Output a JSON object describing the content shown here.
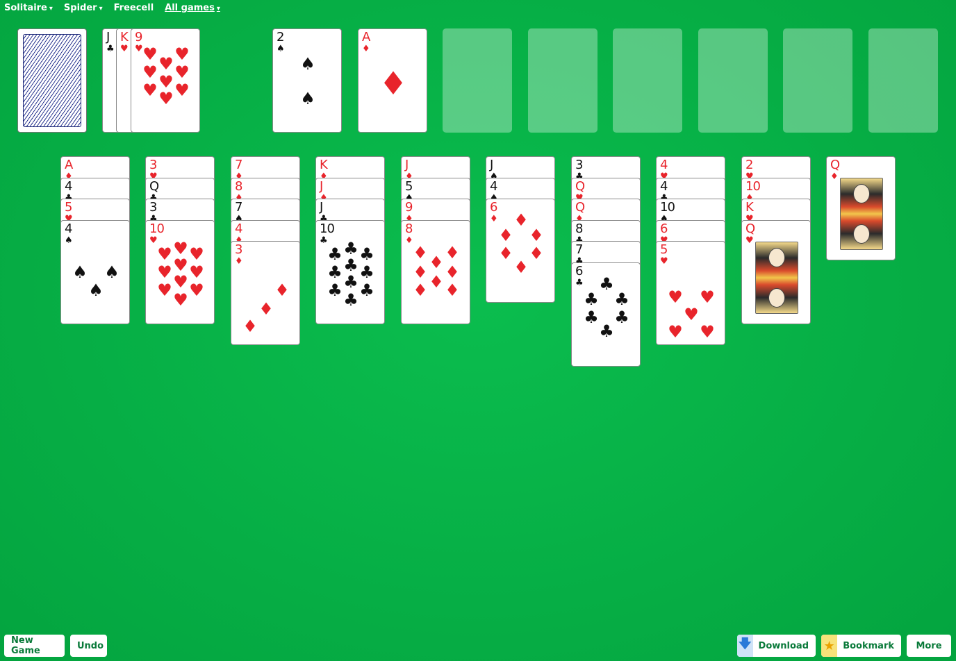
{
  "nav": [
    {
      "label": "Solitaire",
      "caret": "▾",
      "active": false
    },
    {
      "label": "Spider",
      "caret": "▾",
      "active": false
    },
    {
      "label": "Freecell",
      "caret": "",
      "active": false
    },
    {
      "label": "All games",
      "caret": "▾",
      "active": true
    }
  ],
  "stock": {
    "face_down": true
  },
  "waste": [
    {
      "rank": "J",
      "suit": "♣",
      "color": "black"
    },
    {
      "rank": "K",
      "suit": "♥",
      "color": "red"
    },
    {
      "rank": "9",
      "suit": "♥",
      "color": "red"
    }
  ],
  "foundations": [
    {
      "rank": "2",
      "suit": "♠",
      "color": "black"
    },
    {
      "rank": "A",
      "suit": "♦",
      "color": "red"
    },
    null,
    null,
    null,
    null,
    null,
    null
  ],
  "tableau": [
    [
      {
        "rank": "A",
        "suit": "♦",
        "color": "red"
      },
      {
        "rank": "4",
        "suit": "♣",
        "color": "black"
      },
      {
        "rank": "5",
        "suit": "♥",
        "color": "red"
      },
      {
        "rank": "4",
        "suit": "♠",
        "color": "black"
      }
    ],
    [
      {
        "rank": "3",
        "suit": "♥",
        "color": "red"
      },
      {
        "rank": "Q",
        "suit": "♣",
        "color": "black"
      },
      {
        "rank": "3",
        "suit": "♣",
        "color": "black"
      },
      {
        "rank": "10",
        "suit": "♥",
        "color": "red"
      }
    ],
    [
      {
        "rank": "7",
        "suit": "♦",
        "color": "red"
      },
      {
        "rank": "8",
        "suit": "♦",
        "color": "red"
      },
      {
        "rank": "7",
        "suit": "♠",
        "color": "black"
      },
      {
        "rank": "4",
        "suit": "♦",
        "color": "red"
      },
      {
        "rank": "3",
        "suit": "♦",
        "color": "red"
      }
    ],
    [
      {
        "rank": "K",
        "suit": "♦",
        "color": "red"
      },
      {
        "rank": "J",
        "suit": "♦",
        "color": "red"
      },
      {
        "rank": "J",
        "suit": "♣",
        "color": "black"
      },
      {
        "rank": "10",
        "suit": "♣",
        "color": "black"
      }
    ],
    [
      {
        "rank": "J",
        "suit": "♦",
        "color": "red"
      },
      {
        "rank": "5",
        "suit": "♠",
        "color": "black"
      },
      {
        "rank": "9",
        "suit": "♦",
        "color": "red"
      },
      {
        "rank": "8",
        "suit": "♦",
        "color": "red"
      }
    ],
    [
      {
        "rank": "J",
        "suit": "♠",
        "color": "black"
      },
      {
        "rank": "4",
        "suit": "♠",
        "color": "black"
      },
      {
        "rank": "6",
        "suit": "♦",
        "color": "red"
      }
    ],
    [
      {
        "rank": "3",
        "suit": "♣",
        "color": "black"
      },
      {
        "rank": "Q",
        "suit": "♥",
        "color": "red"
      },
      {
        "rank": "Q",
        "suit": "♦",
        "color": "red"
      },
      {
        "rank": "8",
        "suit": "♣",
        "color": "black"
      },
      {
        "rank": "7",
        "suit": "♣",
        "color": "black"
      },
      {
        "rank": "6",
        "suit": "♣",
        "color": "black"
      }
    ],
    [
      {
        "rank": "4",
        "suit": "♥",
        "color": "red"
      },
      {
        "rank": "4",
        "suit": "♣",
        "color": "black"
      },
      {
        "rank": "10",
        "suit": "♠",
        "color": "black"
      },
      {
        "rank": "6",
        "suit": "♥",
        "color": "red"
      },
      {
        "rank": "5",
        "suit": "♥",
        "color": "red"
      }
    ],
    [
      {
        "rank": "2",
        "suit": "♥",
        "color": "red"
      },
      {
        "rank": "10",
        "suit": "♦",
        "color": "red"
      },
      {
        "rank": "K",
        "suit": "♥",
        "color": "red"
      },
      {
        "rank": "Q",
        "suit": "♥",
        "color": "red"
      }
    ],
    [
      {
        "rank": "Q",
        "suit": "♦",
        "color": "red"
      }
    ]
  ],
  "buttons": {
    "new_game": "New Game",
    "undo": "Undo",
    "download": "Download",
    "download_icon": "download-arrow-icon",
    "bookmark": "Bookmark",
    "bookmark_icon": "star-icon",
    "more": "More"
  },
  "colors": {
    "felt": "#06ae45",
    "red_suit": "#e8242b",
    "black_suit": "#111111",
    "button_text": "#0a7a3a"
  }
}
